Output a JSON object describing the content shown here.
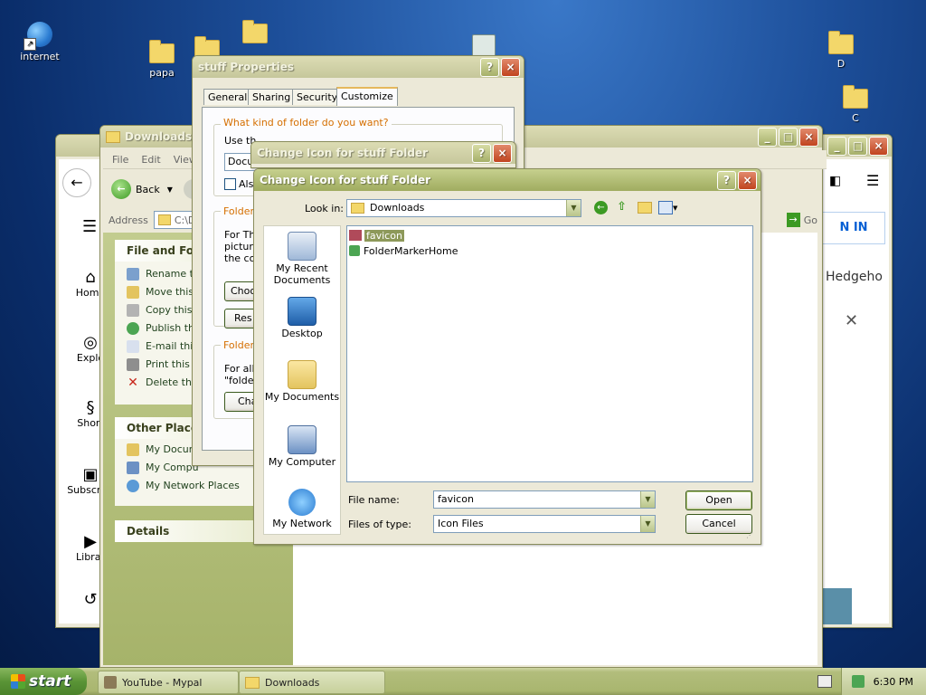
{
  "desktop": {
    "icons": [
      {
        "label": "internet"
      },
      {
        "label": "papa"
      },
      {
        "label": ""
      },
      {
        "label": ""
      },
      {
        "label": "D"
      },
      {
        "label": "C"
      }
    ]
  },
  "browser": {
    "nav": [
      {
        "label": "Home"
      },
      {
        "label": "Explo"
      },
      {
        "label": "Short"
      },
      {
        "label": "Subscript"
      },
      {
        "label": "Librar"
      }
    ],
    "signin": "N IN",
    "chip": "Hedgeho",
    "close": "✕"
  },
  "explorer": {
    "title": "Downloads",
    "menu": [
      "File",
      "Edit",
      "View"
    ],
    "back": "Back",
    "address_label": "Address",
    "address_value": "C:\\Do",
    "go": "Go",
    "panel1_title": "File and Folde",
    "tasks": [
      "Rename th",
      "Move this f",
      "Copy this fi",
      "Publish this",
      "E-mail this",
      "Print this fi",
      "Delete this"
    ],
    "panel2_title": "Other Places",
    "places": [
      "My Docume",
      "My Compu",
      "My Network Places"
    ],
    "panel3_title": "Details"
  },
  "props": {
    "title": "stuff Properties",
    "tabs": [
      "General",
      "Sharing",
      "Security",
      "Customize"
    ],
    "q1": "What kind of folder do you want?",
    "q1_line": "Use th",
    "q1_combo": "Docu",
    "also": "Als",
    "g2_title": "Folder",
    "g2_text1": "For Th",
    "g2_text2": "picture",
    "g2_text3": "the co",
    "choo": "Choo",
    "res": "Res",
    "g3_title": "Folder",
    "g3_text1": "For all",
    "g3_text2": "\"folde",
    "cha": "Cha"
  },
  "dialog_back": {
    "title": "Change Icon for stuff Folder"
  },
  "dialog": {
    "title": "Change Icon for stuff Folder",
    "lookin_label": "Look in:",
    "lookin_value": "Downloads",
    "places": [
      {
        "label": "My Recent Documents"
      },
      {
        "label": "Desktop"
      },
      {
        "label": "My Documents"
      },
      {
        "label": "My Computer"
      },
      {
        "label": "My Network"
      }
    ],
    "files": [
      {
        "name": "favicon",
        "selected": true
      },
      {
        "name": "FolderMarkerHome",
        "selected": false
      }
    ],
    "filename_label": "File name:",
    "filename_value": "favicon",
    "filetype_label": "Files of type:",
    "filetype_value": "Icon Files",
    "open": "Open",
    "cancel": "Cancel"
  },
  "taskbar": {
    "start": "start",
    "items": [
      {
        "label": "YouTube - Mypal"
      },
      {
        "label": "Downloads"
      }
    ],
    "clock": "6:30 PM"
  }
}
